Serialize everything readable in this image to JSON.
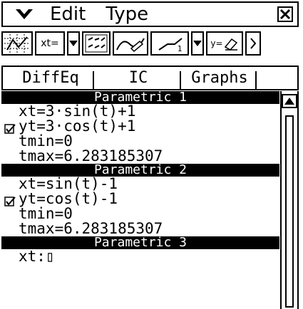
{
  "menu": {
    "edit": "Edit",
    "type": "Type"
  },
  "toolbar": {
    "xt_label": "xt=",
    "sub1_label": "1",
    "y_label": "y="
  },
  "tabs": [
    {
      "label": "DiffEq"
    },
    {
      "label": "IC"
    },
    {
      "label": "Graphs"
    }
  ],
  "entries": [
    {
      "header": "Parametric 1",
      "lines": [
        "xt=3·sin(t)+1",
        "yt=3·cos(t)+1",
        "tmin=0",
        "tmax=6.283185307"
      ],
      "checked": true
    },
    {
      "header": "Parametric 2",
      "lines": [
        "xt=sin(t)-1",
        "yt=cos(t)-1",
        "tmin=0",
        "tmax=6.283185307"
      ],
      "checked": true
    },
    {
      "header": "Parametric 3",
      "lines": [
        "xt:▯"
      ],
      "checked": false
    }
  ],
  "icons": {
    "menu_arrow": "chevron-down-icon",
    "close": "close-icon",
    "check": "checkbox-checked-icon",
    "scroll_up": "scroll-up-icon"
  }
}
